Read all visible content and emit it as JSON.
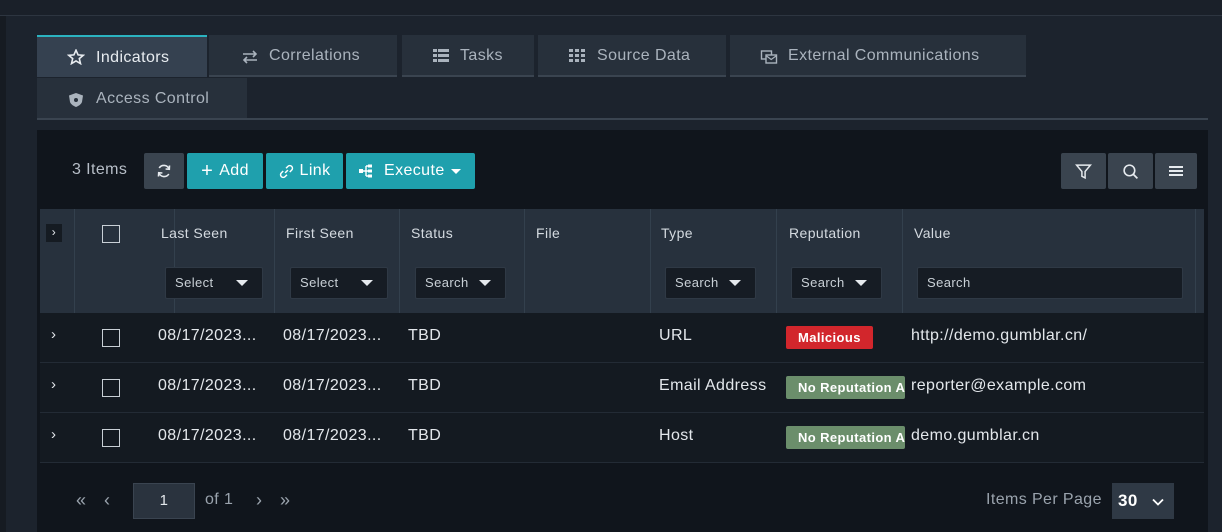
{
  "tabs": [
    {
      "label": "Indicators",
      "icon": "star-icon"
    },
    {
      "label": "Correlations",
      "icon": "arrows-icon"
    },
    {
      "label": "Tasks",
      "icon": "list-icon"
    },
    {
      "label": "Source Data",
      "icon": "grid-icon"
    },
    {
      "label": "External Communications",
      "icon": "communications-icon"
    },
    {
      "label": "Access Control",
      "icon": "shield-icon"
    }
  ],
  "toolbar": {
    "count_label": "3 Items",
    "add_label": "Add",
    "link_label": "Link",
    "execute_label": "Execute"
  },
  "columns": {
    "last_seen": {
      "label": "Last Seen",
      "filter": "Select"
    },
    "first_seen": {
      "label": "First Seen",
      "filter": "Select"
    },
    "status": {
      "label": "Status",
      "filter": "Search"
    },
    "file": {
      "label": "File"
    },
    "type": {
      "label": "Type",
      "filter": "Search"
    },
    "reputation": {
      "label": "Reputation",
      "filter": "Search"
    },
    "value": {
      "label": "Value",
      "placeholder": "Search"
    }
  },
  "rows": [
    {
      "last_seen": "08/17/2023...",
      "first_seen": "08/17/2023...",
      "status": "TBD",
      "file": "",
      "type": "URL",
      "reputation": "Malicious",
      "value": "http://demo.gumblar.cn/"
    },
    {
      "last_seen": "08/17/2023...",
      "first_seen": "08/17/2023...",
      "status": "TBD",
      "file": "",
      "type": "Email Address",
      "reputation": "No Reputation Available",
      "value": "reporter@example.com"
    },
    {
      "last_seen": "08/17/2023...",
      "first_seen": "08/17/2023...",
      "status": "TBD",
      "file": "",
      "type": "Host",
      "reputation": "No Reputation Available",
      "value": "demo.gumblar.cn"
    }
  ],
  "pagination": {
    "page": "1",
    "of_label": "of 1",
    "items_per_page_label": "Items Per Page",
    "items_per_page": "30"
  },
  "colors": {
    "accent": "#1fa0ad",
    "malicious": "#d2262c",
    "no_reputation": "#6b8e6b"
  }
}
